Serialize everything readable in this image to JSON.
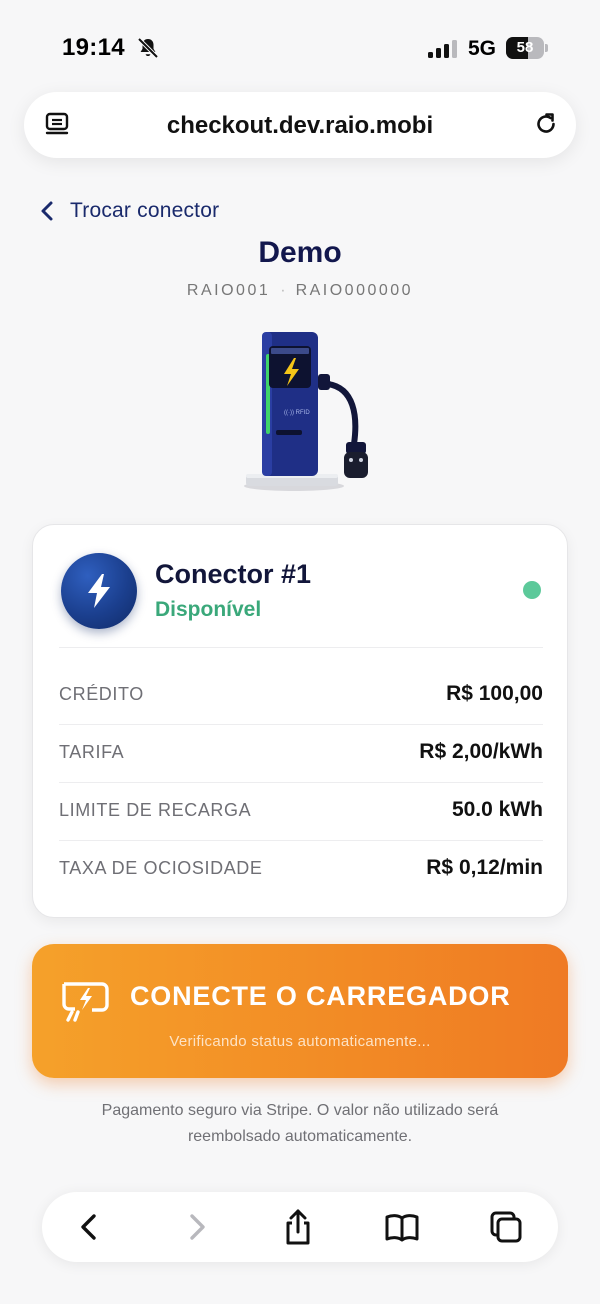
{
  "status_bar": {
    "time": "19:14",
    "network": "5G",
    "battery_level": "58",
    "battery_fraction": 0.58
  },
  "browser": {
    "url": "checkout.dev.raio.mobi",
    "icons": [
      "tabs-menu-icon",
      "reload-icon"
    ]
  },
  "page": {
    "back_label": "Trocar conector",
    "station_title": "Demo",
    "station_code": "RAIO001",
    "station_separator": "·",
    "station_serial": "RAIO000000"
  },
  "connector": {
    "name": "Conector #1",
    "status": "Disponível",
    "status_color": "#3aa87a",
    "details": [
      {
        "label": "CRÉDITO",
        "value": "R$ 100,00"
      },
      {
        "label": "TARIFA",
        "value": "R$ 2,00/kWh"
      },
      {
        "label": "LIMITE DE RECARGA",
        "value": "50.0 kWh"
      },
      {
        "label": "TAXA DE OCIOSIDADE",
        "value": "R$ 0,12/min"
      }
    ]
  },
  "cta": {
    "label": "CONECTE O CARREGADOR",
    "subtext": "Verificando status automaticamente...",
    "color": "#f28a25"
  },
  "footnote": "Pagamento seguro via Stripe. O valor não utilizado será reembolsado automaticamente.",
  "toolbar": {
    "items": [
      "back-icon",
      "forward-icon",
      "share-icon",
      "bookmarks-icon",
      "tabs-icon"
    ]
  }
}
